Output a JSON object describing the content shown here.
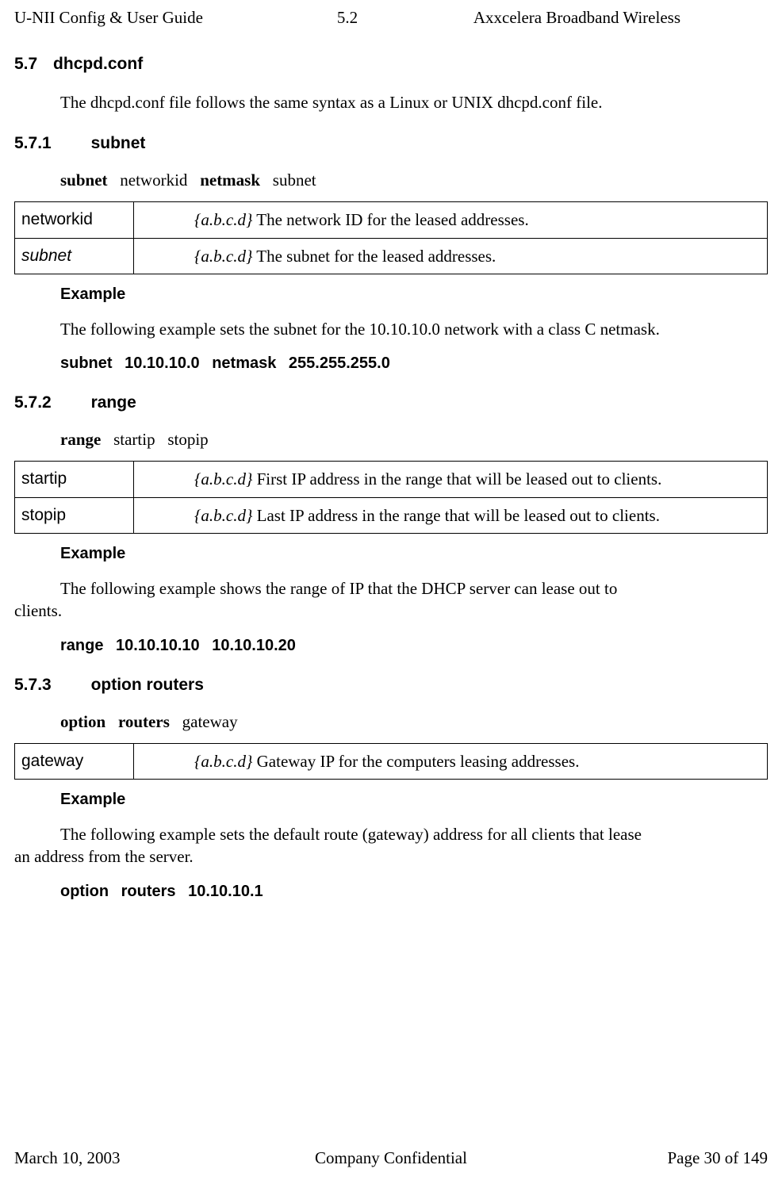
{
  "header": {
    "left": "U-NII Config & User Guide",
    "center": "5.2",
    "right": "Axxcelera Broadband Wireless"
  },
  "footer": {
    "left": "March 10, 2003",
    "center": "Company Confidential",
    "right": "Page 30 of 149"
  },
  "sec57": {
    "num": "5.7",
    "title": "dhcpd.conf",
    "intro": "The dhcpd.conf file follows the same syntax as a Linux or UNIX dhcpd.conf file."
  },
  "sec571": {
    "num": "5.7.1",
    "title": "subnet",
    "syntax_kw1": "subnet",
    "syntax_arg1": "networkid",
    "syntax_kw2": "netmask",
    "syntax_arg2": "subnet",
    "rows": [
      {
        "name": "networkid",
        "name_italic": false,
        "type": "{a.b.c.d}",
        "desc": " The network ID for the leased addresses."
      },
      {
        "name": "subnet",
        "name_italic": true,
        "type": "{a.b.c.d}",
        "desc": " The subnet for the leased addresses."
      }
    ],
    "example_label": "Example",
    "example_text": "The following example sets the subnet for the 10.10.10.0 network with a class C netmask.",
    "example_code": "subnet   10.10.10.0   netmask   255.255.255.0"
  },
  "sec572": {
    "num": "5.7.2",
    "title": "range",
    "syntax_kw1": "range",
    "syntax_arg1": "startip",
    "syntax_arg2": "stopip",
    "rows": [
      {
        "name": "startip",
        "type": "{a.b.c.d}",
        "desc": " First IP address in the range that will be leased out to clients."
      },
      {
        "name": "stopip",
        "type": "{a.b.c.d}",
        "desc": " Last IP address in the range that will be leased out to clients."
      }
    ],
    "example_label": "Example",
    "example_text_part1": "The following example shows the range of IP that the DHCP server can lease out to",
    "example_text_part2": "clients.",
    "example_code": "range   10.10.10.10   10.10.10.20"
  },
  "sec573": {
    "num": "5.7.3",
    "title": "option routers",
    "syntax_kw1": "option",
    "syntax_kw2": "routers",
    "syntax_arg1": "gateway",
    "rows": [
      {
        "name": "gateway",
        "type": "{a.b.c.d}",
        "desc": " Gateway IP for the computers leasing addresses."
      }
    ],
    "example_label": "Example",
    "example_text_part1": "The following example sets the default route (gateway) address for all clients that lease",
    "example_text_part2": "an address from the server.",
    "example_code": "option   routers   10.10.10.1"
  }
}
